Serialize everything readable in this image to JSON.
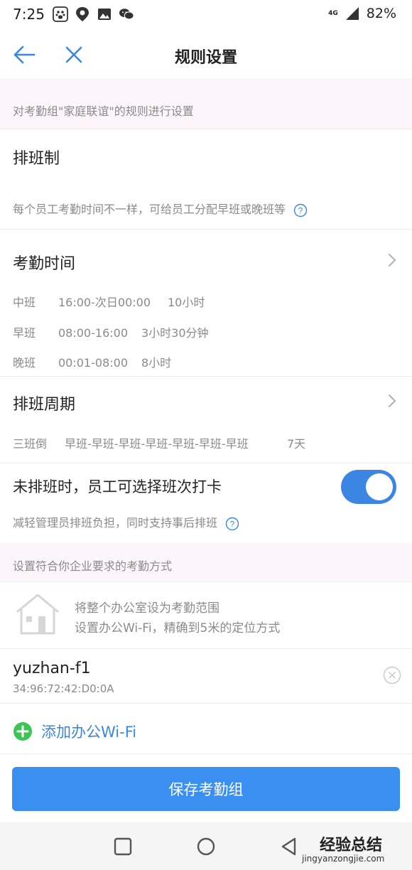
{
  "status_bar": {
    "time": "7:25",
    "network": "4G",
    "battery": "82%",
    "icons": [
      "baidu-paw-icon",
      "location-pin-icon",
      "image-icon",
      "wechat-icon",
      "data-arrows-icon",
      "signal-icon"
    ]
  },
  "nav": {
    "title": "规则设置",
    "back_icon": "arrow-left-icon",
    "close_icon": "close-icon"
  },
  "intro": "对考勤组\"家庭联谊\"的规则进行设置",
  "schedule": {
    "title": "排班制",
    "desc": "每个员工考勤时间不一样，可给员工分配早班或晚班等"
  },
  "attendance_time": {
    "title": "考勤时间",
    "shifts": [
      {
        "name": "中班",
        "time": "16:00-次日00:00",
        "duration": "10小时"
      },
      {
        "name": "早班",
        "time": "08:00-16:00",
        "duration": "3小时30分钟"
      },
      {
        "name": "晚班",
        "time": "00:01-08:00",
        "duration": "8小时"
      }
    ]
  },
  "cycle": {
    "title": "排班周期",
    "name": "三班倒",
    "sequence": "早班-早班-早班-早班-早班-早班-早班",
    "days": "7天"
  },
  "free_select": {
    "title": "未排班时，员工可选择班次打卡",
    "enabled": true,
    "desc": "减轻管理员排班负担，同时支持事后排班"
  },
  "method_hint": "设置符合你企业要求的考勤方式",
  "office_wifi": {
    "line1": "将整个办公室设为考勤范围",
    "line2": "设置办公Wi-Fi，精确到5米的定位方式"
  },
  "wifi_item": {
    "ssid": "yuzhan-f1",
    "mac": "34:96:72:42:D0:0A"
  },
  "add_wifi": "添加办公Wi-Fi",
  "save_button": "保存考勤组",
  "watermark": {
    "text": "经验总结",
    "url": "jingyanzongjie.com"
  },
  "colors": {
    "accent": "#3b86e3",
    "button": "#3a8ff0",
    "add_green": "#3cc455",
    "section_bg": "#fcf6fb"
  }
}
